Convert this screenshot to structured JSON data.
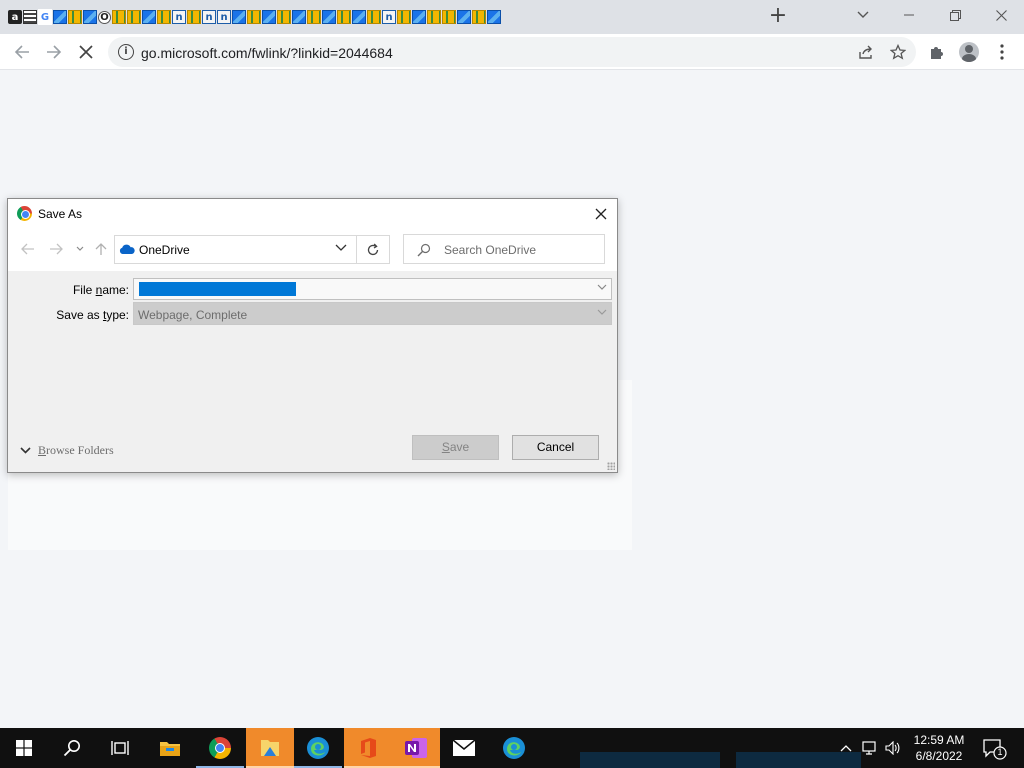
{
  "browser": {
    "tab_favicons": [
      "dark",
      "stk",
      "g",
      "blue",
      "grid",
      "blue",
      "c",
      "grid",
      "grid",
      "blue",
      "grid",
      "n",
      "grid",
      "n",
      "n",
      "blue",
      "grid",
      "blue",
      "grid",
      "blue",
      "grid",
      "blue",
      "grid",
      "blue",
      "grid",
      "n",
      "grid",
      "blue",
      "grid",
      "grid",
      "blue",
      "grid",
      "blue"
    ],
    "new_tab_label": "+",
    "url": "go.microsoft.com/fwlink/?linkid=2044684"
  },
  "dialog": {
    "title": "Save As",
    "location": "OneDrive",
    "search_placeholder": "Search OneDrive",
    "file_name_label_pre": "File ",
    "file_name_label_ul": "n",
    "file_name_label_post": "ame:",
    "file_name_value": "",
    "save_type_label_pre": "Save as ",
    "save_type_label_ul": "t",
    "save_type_label_post": "ype:",
    "save_type_value": "Webpage, Complete",
    "browse_folders_ul": "B",
    "browse_folders_rest": "rowse Folders",
    "save_button_ul": "S",
    "save_button_rest": "ave",
    "cancel_button": "Cancel"
  },
  "taskbar": {
    "apps": [
      "start-icon",
      "search-icon",
      "task-view-icon",
      "file-explorer-icon",
      "chrome-icon",
      "folder-pictures-icon",
      "edge-icon",
      "office-icon",
      "onenote-icon",
      "mail-icon",
      "edge-icon"
    ],
    "time": "12:59 AM",
    "date": "6/8/2022",
    "notification_count": "1"
  },
  "colors": {
    "tab_strip": "#dee1e6",
    "page_bg": "#f3f5f8",
    "selection_blue": "#0078d7",
    "taskbar": "#101010",
    "accent_orange": "#f08a2b"
  }
}
